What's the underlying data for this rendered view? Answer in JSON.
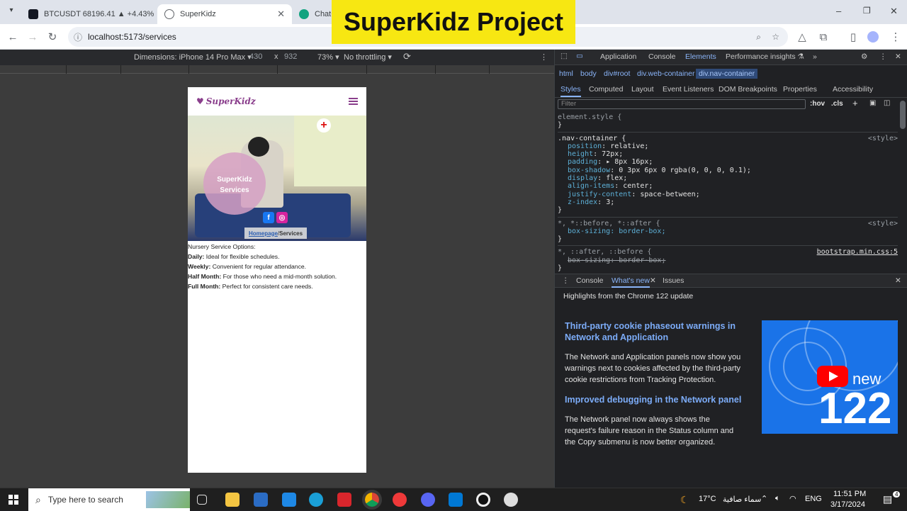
{
  "browser": {
    "tabs": [
      {
        "title": "BTCUSDT 68196.41 ▲ +4.43% B",
        "favicon_color": "#131722"
      },
      {
        "title": "SuperKidz",
        "favicon_color": "#5f6368"
      },
      {
        "title": "ChatGP",
        "favicon_color": "#10a37f"
      }
    ],
    "url": "localhost:5173/services",
    "window_controls": {
      "minimize": "–",
      "restore": "❐",
      "close": "✕"
    }
  },
  "banner": {
    "text": "SuperKidz Project"
  },
  "device_toolbar": {
    "dimensions": "Dimensions: iPhone 14 Pro Max ▾",
    "width": "430",
    "times": "x",
    "height": "932",
    "zoom": "73% ▾",
    "throttling": "No throttling ▾"
  },
  "site": {
    "logo": "SuperKidz",
    "hero_title": "SuperKidz Services",
    "social": [
      "f",
      "◎"
    ],
    "breadcrumb_home": "Homepage",
    "breadcrumb_sep": " /",
    "breadcrumb_current": "Services",
    "intro": "Nursery Service Options:",
    "options": [
      {
        "label": "Daily:",
        "text": " Ideal for flexible schedules."
      },
      {
        "label": "Weekly:",
        "text": " Convenient for regular attendance."
      },
      {
        "label": "Half Month:",
        "text": " For those who need a mid-month solution."
      },
      {
        "label": "Full Month:",
        "text": " Perfect for consistent care needs."
      }
    ]
  },
  "devtools": {
    "tabs": [
      "Application",
      "Console",
      "Elements",
      "Performance insights ⚗",
      "»"
    ],
    "breadcrumb": [
      "html",
      "body",
      "div#root",
      "div.web-container",
      "div.nav-container"
    ],
    "subtabs": [
      "Styles",
      "Computed",
      "Layout",
      "Event Listeners",
      "DOM Breakpoints",
      "Properties",
      "Accessibility"
    ],
    "filter_placeholder": "Filter",
    "filter_tools": [
      ":hov",
      ".cls",
      "+"
    ],
    "element_style": "element.style {",
    "rule_selector": ".nav-container {",
    "rule_source": "<style>",
    "props": [
      {
        "name": "position",
        "value": "relative;"
      },
      {
        "name": "height",
        "value": "72px;"
      },
      {
        "name": "padding",
        "value": "▸ 8px 16px;"
      },
      {
        "name": "box-shadow",
        "value": "0 3px 6px 0 rgba(0, 0, 0, 0.1);"
      },
      {
        "name": "display",
        "value": "flex;"
      },
      {
        "name": "align-items",
        "value": "center;"
      },
      {
        "name": "justify-content",
        "value": "space-between;"
      },
      {
        "name": "z-index",
        "value": "3;"
      }
    ],
    "rule2_selector": "*, *::before, *::after {",
    "rule2_source": "<style>",
    "rule2_prop": "box-sizing: border-box;",
    "rule3_selector": "*, ::after, ::before {",
    "rule3_source": "bootstrap.min.css:5",
    "rule3_prop": "box-sizing: border-box;",
    "close_brace": "}",
    "drawer_tabs": [
      "Console",
      "What's new",
      "Issues"
    ],
    "whatsnew_header": "Highlights from the Chrome 122 update",
    "articles": [
      {
        "title": "Third-party cookie phaseout warnings in Network and Application",
        "body": "The Network and Application panels now show you warnings next to cookies affected by the third-party cookie restrictions from Tracking Protection."
      },
      {
        "title": "Improved debugging in the Network panel",
        "body": "The Network panel now always shows the request's failure reason in the Status column and the Copy submenu is now better organized."
      }
    ],
    "thumb_new": "new",
    "thumb_num": "122"
  },
  "taskbar": {
    "search_placeholder": "Type here to search",
    "weather": "17°C",
    "weather_text": "سماء صافية",
    "language": "ENG",
    "time": "11:51 PM",
    "date": "3/17/2024",
    "notification_count": "4"
  }
}
